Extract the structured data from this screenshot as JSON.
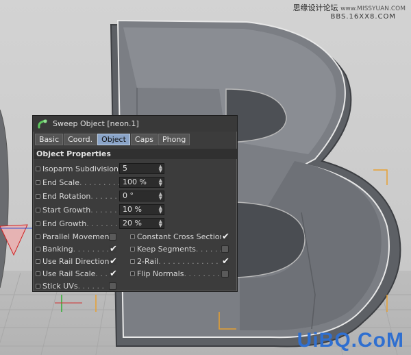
{
  "watermark": {
    "top_text": "思缘设计论坛",
    "top_url": "www.MISSYUAN.COM",
    "sub_text": "BBS.16XX8.COM",
    "bottom_text": "UiBQ.CoM"
  },
  "dialog": {
    "title": "Sweep Object [neon.1]",
    "icon": "sweep-object-icon",
    "tabs": [
      {
        "label": "Basic",
        "active": false
      },
      {
        "label": "Coord.",
        "active": false
      },
      {
        "label": "Object",
        "active": true
      },
      {
        "label": "Caps",
        "active": false
      },
      {
        "label": "Phong",
        "active": false
      }
    ],
    "section": "Object Properties",
    "fields": [
      {
        "label": "Isoparm Subdivision",
        "dots": "",
        "value": "5"
      },
      {
        "label": "End Scale",
        "dots": " . . . . . . . . .",
        "value": "100 %"
      },
      {
        "label": "End Rotation",
        "dots": " . . . . . .",
        "value": "0 °"
      },
      {
        "label": "Start Growth",
        "dots": ". . . . . .",
        "value": "10 %"
      },
      {
        "label": "End Growth",
        "dots": " . . . . . . .",
        "value": "20 %"
      }
    ],
    "checks_left": [
      {
        "label": "Parallel Movement",
        "dots": "",
        "checked": false
      },
      {
        "label": "Banking",
        "dots": " . . . . . . . . .",
        "checked": true
      },
      {
        "label": "Use Rail Direction",
        "dots": "",
        "checked": true
      },
      {
        "label": "Use Rail Scale",
        "dots": " . . . .",
        "checked": true
      },
      {
        "label": "Stick UVs",
        "dots": ". . . . . .",
        "checked": false
      }
    ],
    "checks_right": [
      {
        "label": "Constant Cross Section",
        "dots": "",
        "checked": true
      },
      {
        "label": "Keep Segments",
        "dots": ". . . . . .",
        "checked": false
      },
      {
        "label": "2-Rail",
        "dots": ". . . . . . . . . . . . . . .",
        "checked": true
      },
      {
        "label": "Flip Normals",
        "dots": " . . . . . . . .",
        "checked": false
      }
    ],
    "checkmark": "✔"
  },
  "colors": {
    "watermark_blue": "#2f6fd0",
    "tab_active": "#8aa4c8",
    "panel_bg": "#3c3c3c",
    "spline_orange": "#e8a030"
  }
}
